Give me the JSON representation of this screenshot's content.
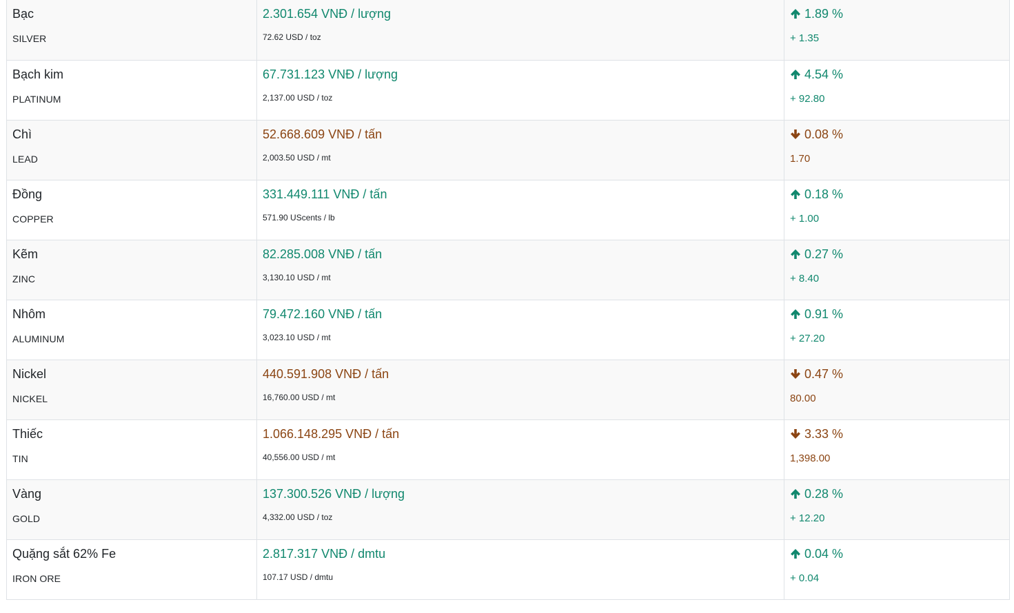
{
  "colors": {
    "up": "#11886e",
    "down": "#8b4513"
  },
  "rows": [
    {
      "name": "Bạc",
      "code": "SILVER",
      "price": "2.301.654 VNĐ / lượng",
      "usd": "72.62 USD / toz",
      "pct": "1.89 %",
      "delta": "+ 1.35",
      "direction": "up"
    },
    {
      "name": "Bạch kim",
      "code": "PLATINUM",
      "price": "67.731.123 VNĐ / lượng",
      "usd": "2,137.00 USD / toz",
      "pct": "4.54 %",
      "delta": "+ 92.80",
      "direction": "up"
    },
    {
      "name": "Chì",
      "code": "LEAD",
      "price": "52.668.609 VNĐ / tấn",
      "usd": "2,003.50 USD / mt",
      "pct": "0.08 %",
      "delta": "1.70",
      "direction": "down"
    },
    {
      "name": "Đồng",
      "code": "COPPER",
      "price": "331.449.111 VNĐ / tấn",
      "usd": "571.90 UScents / lb",
      "pct": "0.18 %",
      "delta": "+ 1.00",
      "direction": "up"
    },
    {
      "name": "Kẽm",
      "code": "ZINC",
      "price": "82.285.008 VNĐ / tấn",
      "usd": "3,130.10 USD / mt",
      "pct": "0.27 %",
      "delta": "+ 8.40",
      "direction": "up"
    },
    {
      "name": "Nhôm",
      "code": "ALUMINUM",
      "price": "79.472.160 VNĐ / tấn",
      "usd": "3,023.10 USD / mt",
      "pct": "0.91 %",
      "delta": "+ 27.20",
      "direction": "up"
    },
    {
      "name": "Nickel",
      "code": "NICKEL",
      "price": "440.591.908 VNĐ / tấn",
      "usd": "16,760.00 USD / mt",
      "pct": "0.47 %",
      "delta": "80.00",
      "direction": "down"
    },
    {
      "name": "Thiếc",
      "code": "TIN",
      "price": "1.066.148.295 VNĐ / tấn",
      "usd": "40,556.00 USD / mt",
      "pct": "3.33 %",
      "delta": "1,398.00",
      "direction": "down"
    },
    {
      "name": "Vàng",
      "code": "GOLD",
      "price": "137.300.526 VNĐ / lượng",
      "usd": "4,332.00 USD / toz",
      "pct": "0.28 %",
      "delta": "+ 12.20",
      "direction": "up"
    },
    {
      "name": "Quặng sắt 62% Fe",
      "code": "IRON ORE",
      "price": "2.817.317 VNĐ / dmtu",
      "usd": "107.17 USD / dmtu",
      "pct": "0.04 %",
      "delta": "+ 0.04",
      "direction": "up"
    }
  ]
}
